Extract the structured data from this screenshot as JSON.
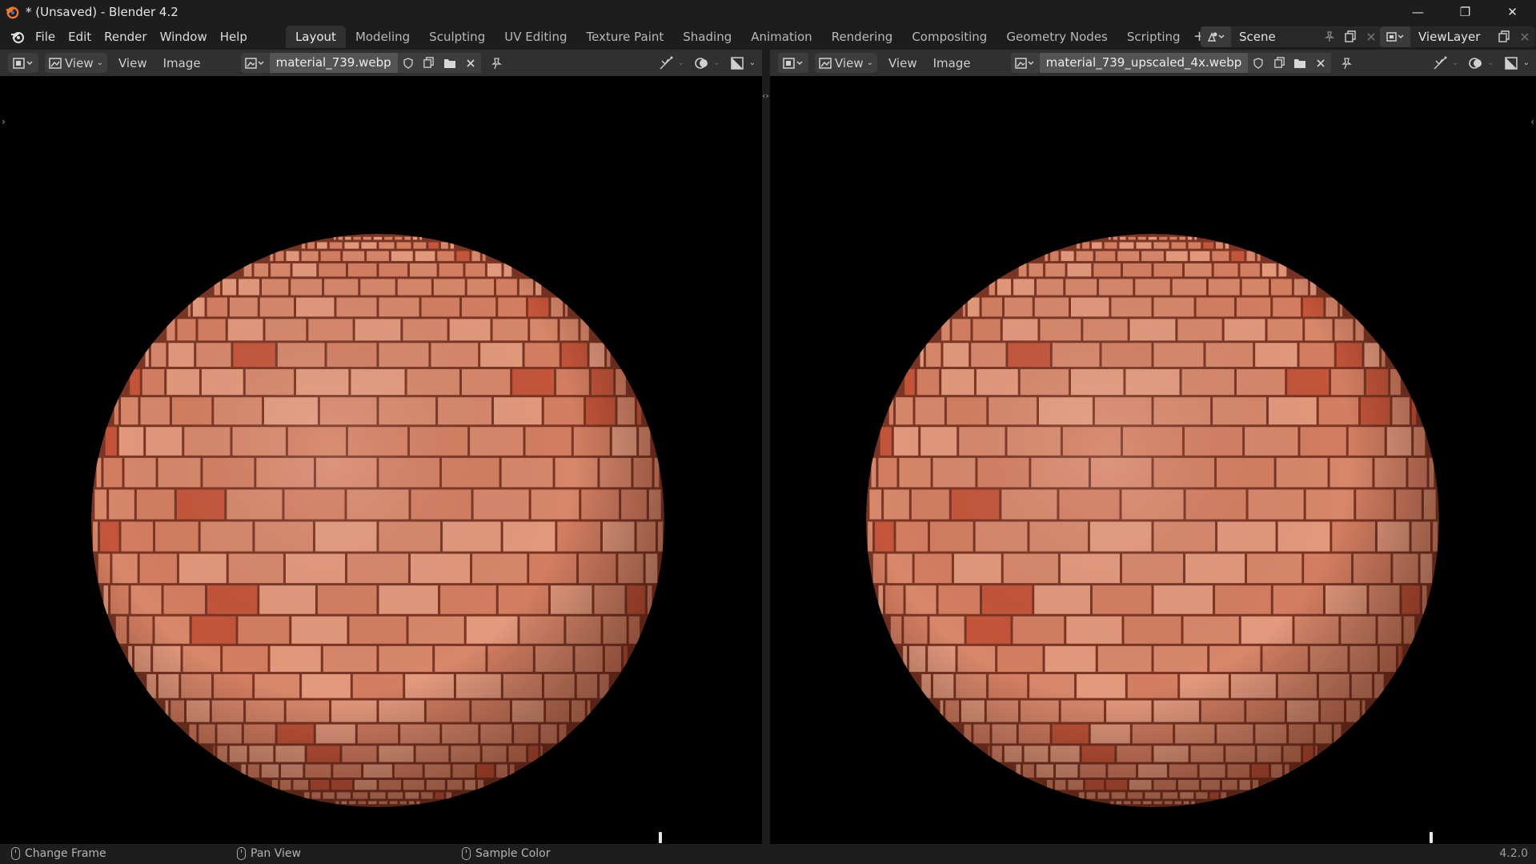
{
  "window": {
    "title": "* (Unsaved) - Blender 4.2",
    "minimize": "—",
    "restore": "❐",
    "close": "✕"
  },
  "menu": [
    "File",
    "Edit",
    "Render",
    "Window",
    "Help"
  ],
  "workspaces": [
    "Layout",
    "Modeling",
    "Sculpting",
    "UV Editing",
    "Texture Paint",
    "Shading",
    "Animation",
    "Rendering",
    "Compositing",
    "Geometry Nodes",
    "Scripting"
  ],
  "active_workspace": "Layout",
  "scene": {
    "name": "Scene"
  },
  "view_layer": {
    "name": "ViewLayer"
  },
  "editors": {
    "left": {
      "mode_label": "View",
      "menu_view": "View",
      "menu_image": "Image",
      "image_name": "material_739.webp"
    },
    "right": {
      "mode_label": "View",
      "menu_view": "View",
      "menu_image": "Image",
      "image_name": "material_739_upscaled_4x.webp"
    }
  },
  "statusbar": {
    "hint1": "Change Frame",
    "hint2": "Pan View",
    "hint3": "Sample Color",
    "version": "4.2.0"
  },
  "colors": {
    "brick": "#d8876a",
    "mortar": "#7a3524",
    "active_tab": "#303030"
  }
}
